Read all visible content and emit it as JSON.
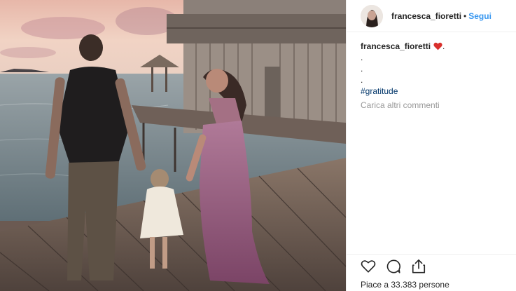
{
  "post": {
    "photo": {
      "icon": "beach-family-photo",
      "colors": {
        "sky": "#e9c2b2",
        "sea": "#7f8f96",
        "deck": "#6d5b52",
        "dress": "#9a5a86"
      }
    },
    "author": {
      "username": "francesca_fioretti",
      "separator": "•",
      "follow_label": "Segui"
    },
    "caption": {
      "username": "francesca_fioretti",
      "emoji_icon": "heart-icon",
      "trailing": ".",
      "lines": [
        ".",
        ".",
        "."
      ],
      "hashtag": "#gratitude"
    },
    "load_more_label": "Carica altri commenti",
    "actions": {
      "like_icon": "heart-outline-icon",
      "comment_icon": "comment-icon",
      "share_icon": "share-icon"
    },
    "likes_text": "Piace a 33.383 persone"
  }
}
